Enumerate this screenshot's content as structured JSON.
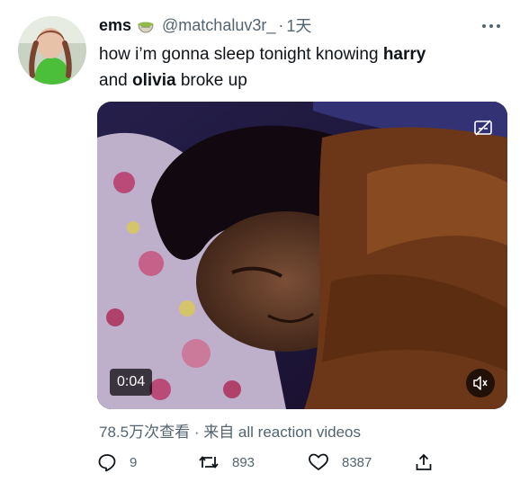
{
  "tweet": {
    "display_name": "ems",
    "handle": "@matchaluv3r_",
    "separator": "·",
    "time": "1天",
    "text_1": "how i’m gonna sleep tonight knowing ",
    "bold_1": "harry",
    "text_2": "and ",
    "bold_2": "olivia",
    "text_3": " broke up"
  },
  "media": {
    "duration": "0:04"
  },
  "meta": {
    "views": "78.5万次查看",
    "separator": " · ",
    "source": "来自 all reaction videos"
  },
  "actions": {
    "replies": "9",
    "retweets": "893",
    "likes": "8387"
  },
  "icons": {
    "more": "more-icon",
    "emoji": "matcha-tea-icon",
    "captions": "captions-off-icon",
    "mute": "speaker-muted-icon",
    "reply": "reply-icon",
    "retweet": "retweet-icon",
    "like": "heart-icon",
    "share": "share-icon"
  },
  "colors": {
    "text": "#0f1419",
    "secondary": "#536471",
    "background": "#ffffff"
  }
}
